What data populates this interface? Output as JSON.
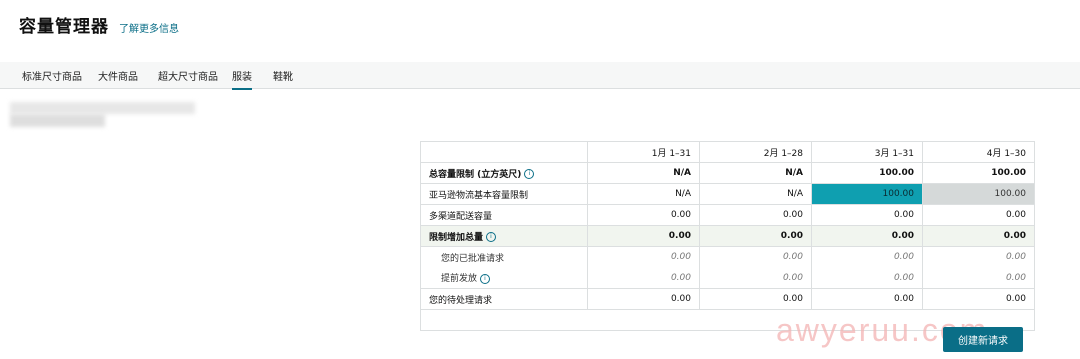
{
  "page": {
    "title": "容量管理器",
    "learn_more": "了解更多信息"
  },
  "tabs": [
    {
      "label": "标准尺寸商品",
      "active": false
    },
    {
      "label": "大件商品",
      "active": false
    },
    {
      "label": "超大尺寸商品",
      "active": false
    },
    {
      "label": "服装",
      "active": true
    },
    {
      "label": "鞋靴",
      "active": false
    }
  ],
  "table": {
    "columns": [
      "",
      "1月 1–31",
      "2月 1–28",
      "3月 1–31",
      "4月 1–30"
    ],
    "rows": [
      {
        "label": "总容量限制 (立方英尺)",
        "info": true,
        "values": [
          "N/A",
          "N/A",
          "100.00",
          "100.00"
        ]
      },
      {
        "label": "亚马逊物流基本容量限制",
        "info": false,
        "values": [
          "N/A",
          "N/A",
          "100.00",
          "100.00"
        ]
      },
      {
        "label": "多渠道配送容量",
        "info": false,
        "values": [
          "0.00",
          "0.00",
          "0.00",
          "0.00"
        ]
      },
      {
        "label": "限制增加总量",
        "info": true,
        "values": [
          "0.00",
          "0.00",
          "0.00",
          "0.00"
        ]
      },
      {
        "label": "您的已批准请求",
        "info": false,
        "values": [
          "0.00",
          "0.00",
          "0.00",
          "0.00"
        ]
      },
      {
        "label": "提前发放",
        "info": true,
        "values": [
          "0.00",
          "0.00",
          "0.00",
          "0.00"
        ]
      },
      {
        "label": "您的待处理请求",
        "info": false,
        "values": [
          "0.00",
          "0.00",
          "0.00",
          "0.00"
        ]
      }
    ]
  },
  "actions": {
    "create_request": "创建新请求"
  },
  "icons": {
    "info": "info-circle-icon"
  },
  "colors": {
    "accent": "#0a6e87",
    "highlight_teal": "#0f9fb0",
    "highlight_grey": "#d5d9d9"
  },
  "watermark": "awyeruu.com"
}
